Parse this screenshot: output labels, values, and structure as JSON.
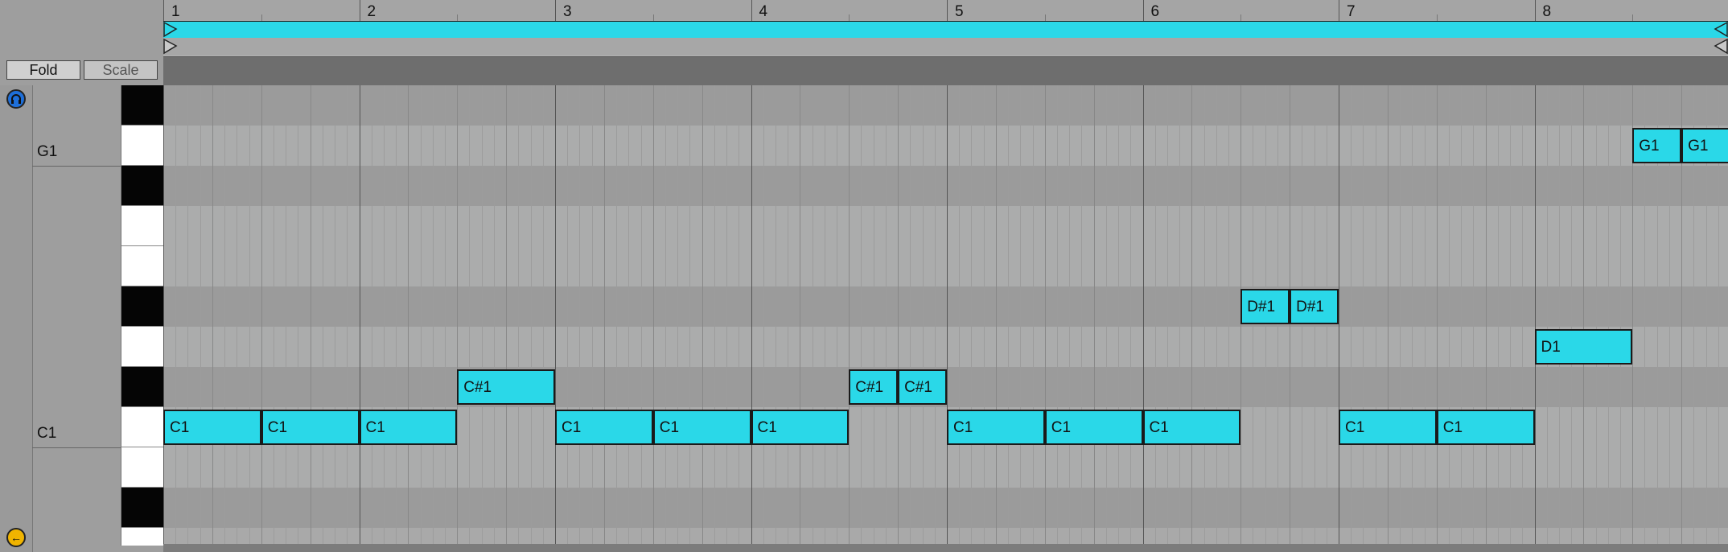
{
  "ruler": {
    "bars": [
      "1",
      "2",
      "3",
      "4",
      "5",
      "6",
      "7",
      "8"
    ]
  },
  "toolbar": {
    "fold_label": "Fold",
    "scale_label": "Scale"
  },
  "keyboard": {
    "octave_labels": [
      "G1",
      "C1"
    ]
  },
  "colors": {
    "note": "#2ad8e8",
    "loop": "#2ad8e8",
    "preview_button": "#1e6fd9",
    "fold_arrow_button": "#f0b400"
  },
  "icons": {
    "preview": "headphones-icon",
    "fold_arrow": "left-arrow-icon"
  },
  "notes": [
    {
      "label": "C1",
      "pitch": "C1",
      "start": 1.0,
      "length": 0.5
    },
    {
      "label": "C1",
      "pitch": "C1",
      "start": 1.5,
      "length": 0.5
    },
    {
      "label": "C1",
      "pitch": "C1",
      "start": 2.0,
      "length": 0.5
    },
    {
      "label": "C#1",
      "pitch": "C#1",
      "start": 2.5,
      "length": 0.5
    },
    {
      "label": "C1",
      "pitch": "C1",
      "start": 3.0,
      "length": 0.5
    },
    {
      "label": "C1",
      "pitch": "C1",
      "start": 3.5,
      "length": 0.5
    },
    {
      "label": "C1",
      "pitch": "C1",
      "start": 4.0,
      "length": 0.5
    },
    {
      "label": "C#1",
      "pitch": "C#1",
      "start": 4.5,
      "length": 0.25
    },
    {
      "label": "C#1",
      "pitch": "C#1",
      "start": 4.75,
      "length": 0.25
    },
    {
      "label": "C1",
      "pitch": "C1",
      "start": 5.0,
      "length": 0.5
    },
    {
      "label": "C1",
      "pitch": "C1",
      "start": 5.5,
      "length": 0.5
    },
    {
      "label": "C1",
      "pitch": "C1",
      "start": 6.0,
      "length": 0.5
    },
    {
      "label": "D#1",
      "pitch": "D#1",
      "start": 6.5,
      "length": 0.25
    },
    {
      "label": "D#1",
      "pitch": "D#1",
      "start": 6.75,
      "length": 0.25
    },
    {
      "label": "C1",
      "pitch": "C1",
      "start": 7.0,
      "length": 0.5
    },
    {
      "label": "C1",
      "pitch": "C1",
      "start": 7.5,
      "length": 0.5
    },
    {
      "label": "D1",
      "pitch": "D1",
      "start": 8.0,
      "length": 0.5
    },
    {
      "label": "G1",
      "pitch": "G1",
      "start": 8.5,
      "length": 0.25
    },
    {
      "label": "G1",
      "pitch": "G1",
      "start": 8.75,
      "length": 0.25
    }
  ]
}
